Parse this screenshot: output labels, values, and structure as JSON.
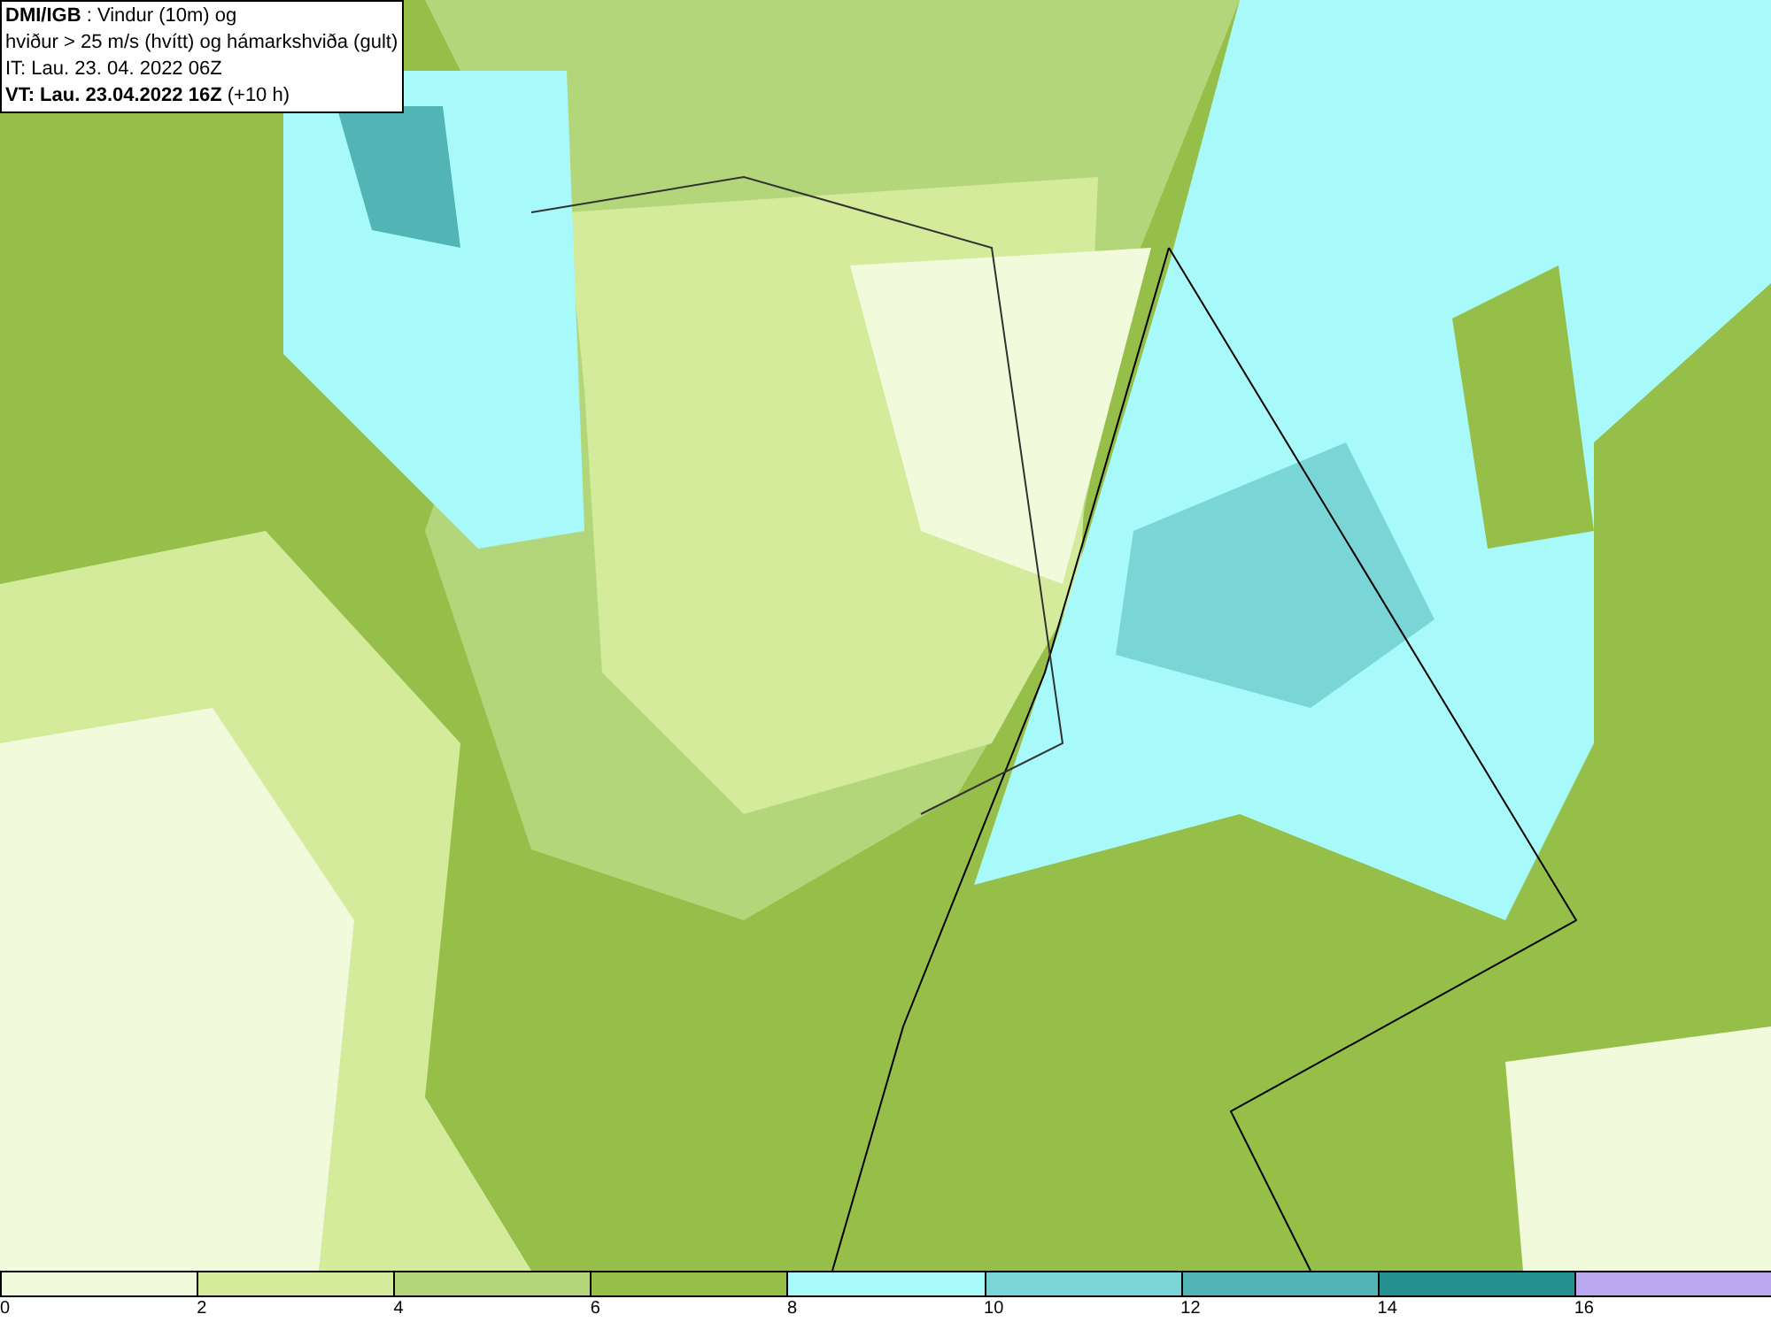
{
  "title_box": {
    "lines": [
      "**DMI/IGB** : Vindur (10m) og",
      "hviður > 25 m/s (hvítt) og hámarkshviða (gult)",
      "IT: Lau. 23. 04. 2022 06Z",
      "**VT: Lau. 23.04.2022 16Z** (+10 h)"
    ]
  },
  "legend": {
    "segments": [
      {
        "color": "#f2fadc"
      },
      {
        "color": "#d4eb9c"
      },
      {
        "color": "#b4d67a"
      },
      {
        "color": "#96bf4a"
      },
      {
        "color": "#a8fafa"
      },
      {
        "color": "#7ad6d6"
      },
      {
        "color": "#52b4b4"
      },
      {
        "color": "#259090"
      },
      {
        "color": "#baa8f0"
      }
    ],
    "ticks": [
      "0",
      "2",
      "4",
      "6",
      "8",
      "10",
      "12",
      "14",
      "16"
    ]
  }
}
